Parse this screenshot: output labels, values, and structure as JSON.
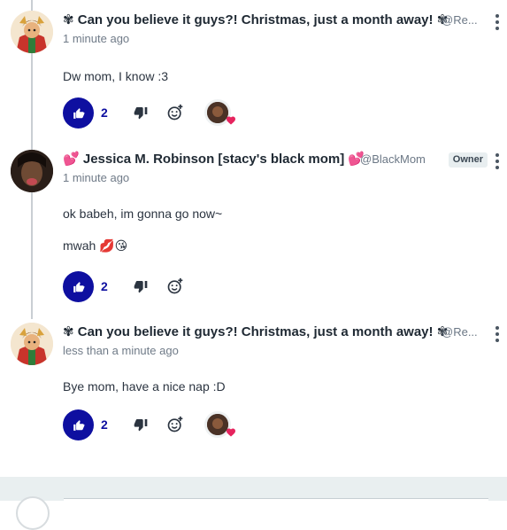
{
  "comments": [
    {
      "prefix": "✾",
      "name": "Can you believe it guys?! Christmas, just a month away!",
      "suffix": "✾",
      "handle": "@Re...",
      "timestamp": "1 minute ago",
      "lines": [
        "Dw mom, I know :3"
      ],
      "likes": "2",
      "has_reaction": true,
      "avatar": "santa-avatar"
    },
    {
      "prefix": "💕",
      "name": "Jessica M. Robinson [stacy's black mom]",
      "suffix": "💕",
      "handle": "@BlackMom",
      "badge": "Owner",
      "timestamp": "1 minute ago",
      "lines": [
        "ok babeh, im gonna go now~",
        "mwah 💋😘"
      ],
      "likes": "2",
      "has_reaction": false,
      "avatar": "dark-avatar"
    },
    {
      "prefix": "✾",
      "name": "Can you believe it guys?! Christmas, just a month away!",
      "suffix": "✾",
      "handle": "@Re...",
      "timestamp": "less than a minute ago",
      "lines": [
        "Bye mom, have a nice nap :D"
      ],
      "likes": "2",
      "has_reaction": true,
      "avatar": "santa-avatar"
    }
  ],
  "icons": {
    "like": "thumbs-up-icon",
    "dislike": "thumbs-down-icon",
    "react": "add-reaction-icon",
    "more": "kebab-menu-icon",
    "reaction_heart": "heart-icon"
  },
  "colors": {
    "accent": "#0e0fa0",
    "badge_bg": "#e8eef0",
    "composer_bg": "#e9eff0",
    "heart": "#e6245e"
  }
}
